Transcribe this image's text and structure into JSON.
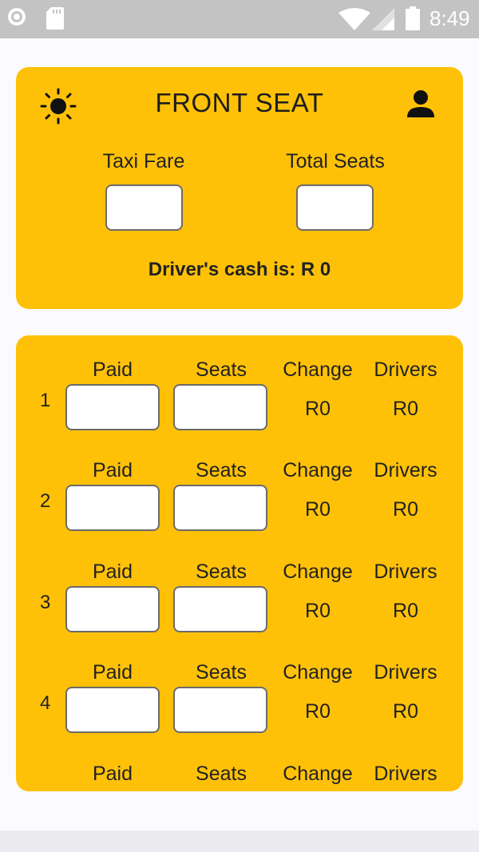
{
  "status_bar": {
    "time": "8:49"
  },
  "header": {
    "title": "FRONT SEAT",
    "left_icon": "sun-icon",
    "right_icon": "person-icon"
  },
  "summary": {
    "fare_label": "Taxi Fare",
    "fare_value": "",
    "seats_label": "Total Seats",
    "seats_value": "",
    "cash_text": "Driver's cash is: R 0"
  },
  "columns": {
    "paid": "Paid",
    "seats": "Seats",
    "change": "Change",
    "drivers": "Drivers"
  },
  "rows": [
    {
      "num": "1",
      "paid": "",
      "seats": "",
      "change": "R0",
      "drivers": "R0"
    },
    {
      "num": "2",
      "paid": "",
      "seats": "",
      "change": "R0",
      "drivers": "R0"
    },
    {
      "num": "3",
      "paid": "",
      "seats": "",
      "change": "R0",
      "drivers": "R0"
    },
    {
      "num": "4",
      "paid": "",
      "seats": "",
      "change": "R0",
      "drivers": "R0"
    },
    {
      "num": "",
      "paid": "",
      "seats": "",
      "change": "",
      "drivers": ""
    }
  ],
  "colors": {
    "accent": "#ffc107",
    "background": "#fbfafd",
    "status_bar": "#c3c3c3"
  }
}
